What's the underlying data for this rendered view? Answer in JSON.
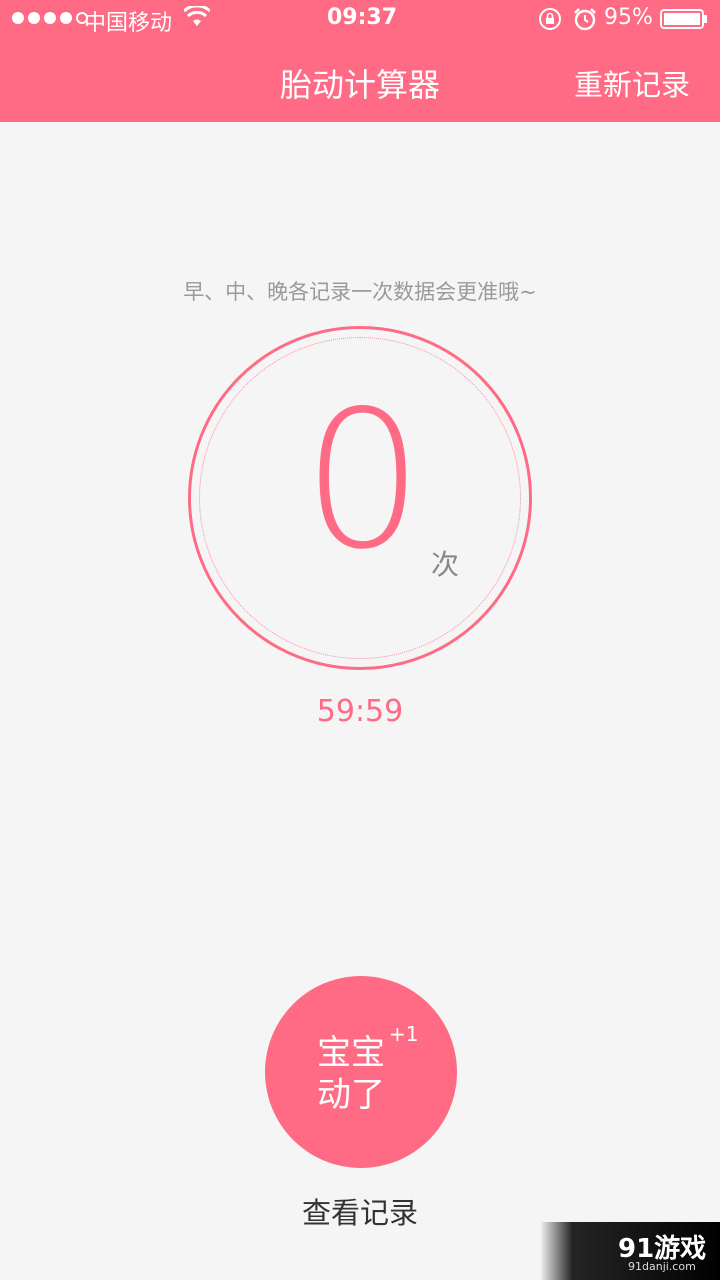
{
  "status_bar": {
    "carrier": "中国移动",
    "time": "09:37",
    "battery": "95%"
  },
  "nav": {
    "title": "胎动计算器",
    "action": "重新记录"
  },
  "hint": "早、中、晚各记录一次数据会更准哦~",
  "counter": {
    "value": "0",
    "unit": "次"
  },
  "timer": "59:59",
  "kick_button": {
    "label_line1": "宝宝",
    "label_line2": "动了",
    "increment": "+1"
  },
  "records_link": "查看记录",
  "watermark": {
    "text": "91游戏",
    "sub": "91danji.com"
  },
  "colors": {
    "accent": "#ff6b85",
    "background": "#f5f5f5"
  }
}
